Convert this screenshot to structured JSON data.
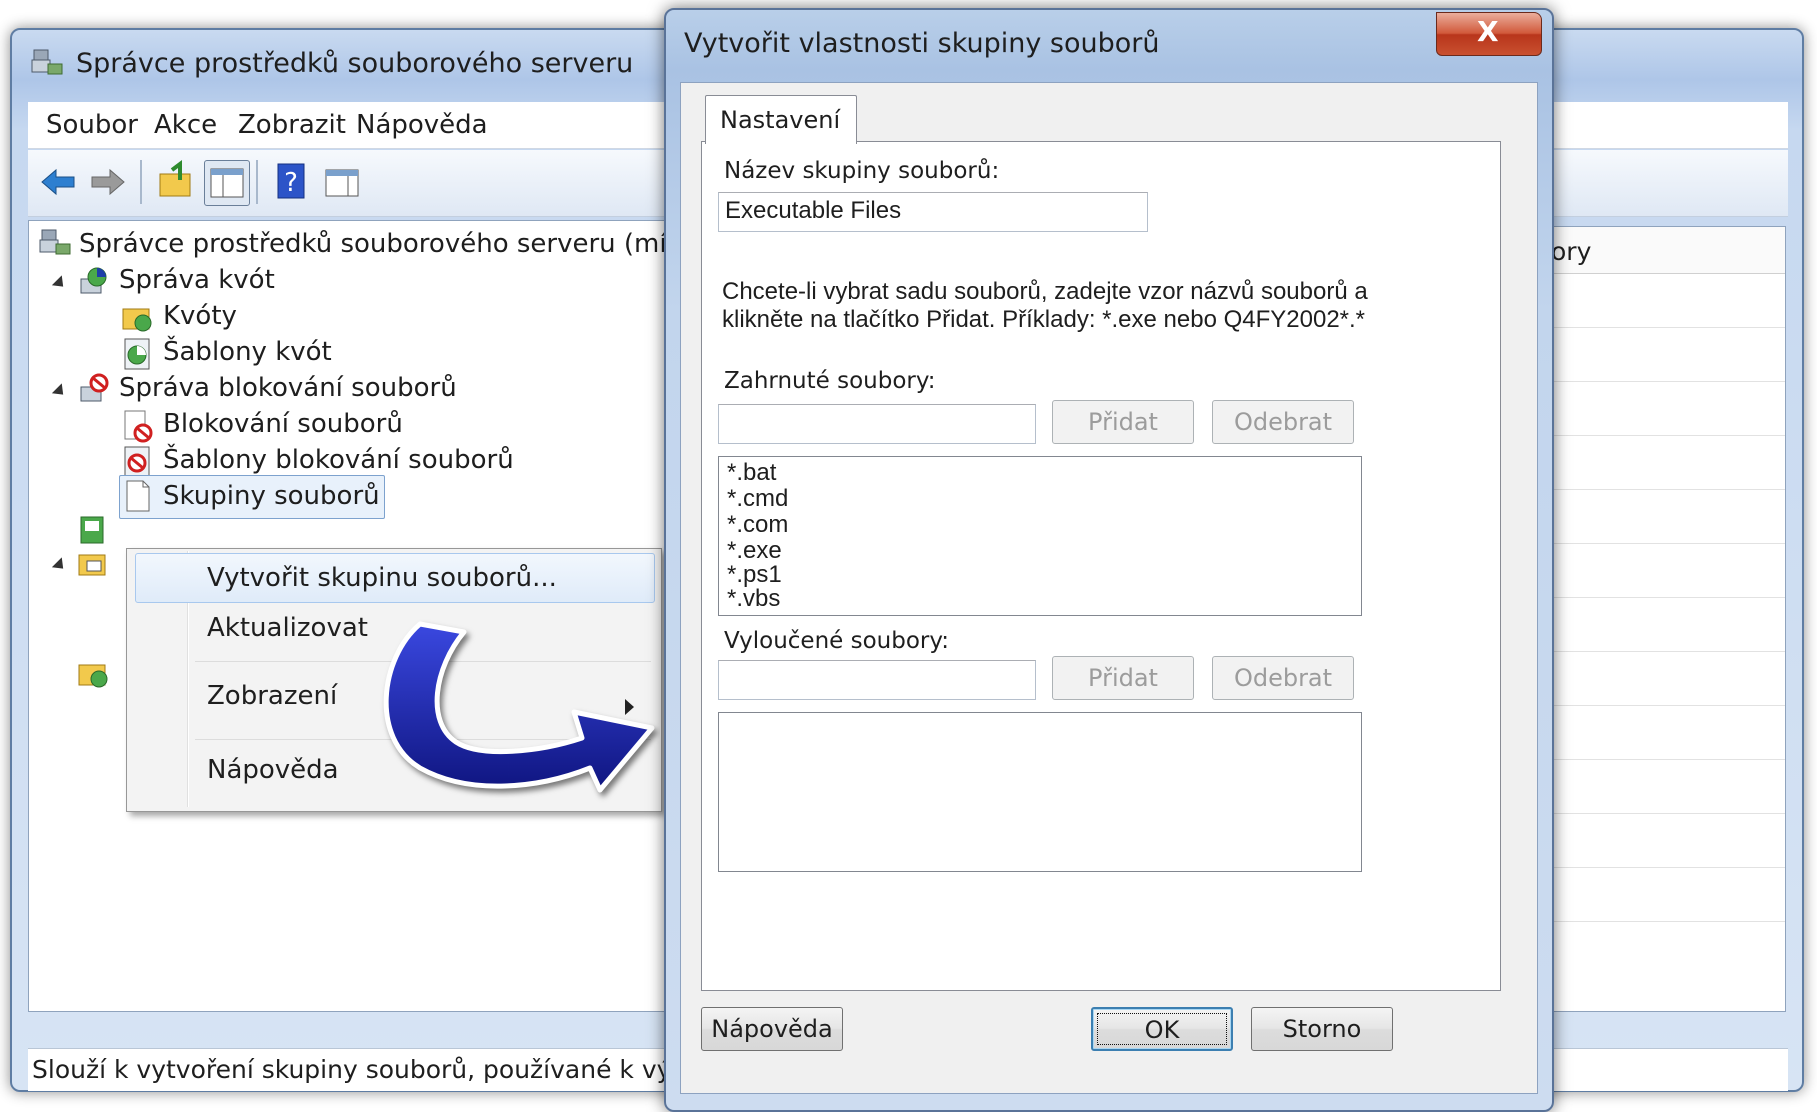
{
  "main_window": {
    "title": "Správce prostředků souborového serveru",
    "menu": [
      "Soubor",
      "Akce",
      "Zobrazit",
      "Nápověda"
    ],
    "toolbar_icons": [
      "back-arrow-icon",
      "forward-arrow-icon",
      "up-folder-icon",
      "show-hide-tree-icon",
      "help-icon",
      "action-pane-icon"
    ],
    "tree": {
      "root": "Správce prostředků souborového serveru (místní)",
      "items": [
        {
          "label": "Správa kvót",
          "icon": "quota-management-icon"
        },
        {
          "label": "Kvóty",
          "icon": "quotas-folder-icon"
        },
        {
          "label": "Šablony kvót",
          "icon": "quota-templates-icon"
        },
        {
          "label": "Správa blokování souborů",
          "icon": "file-screening-icon"
        },
        {
          "label": "Blokování souborů",
          "icon": "file-screens-icon"
        },
        {
          "label": "Šablony blokování souborů",
          "icon": "file-screen-templates-icon"
        },
        {
          "label": "Skupiny souborů",
          "icon": "file-groups-icon"
        }
      ]
    },
    "right_header_partial": "ory",
    "status_text": "Slouží k vytvoření skupiny souborů, používané k výbě"
  },
  "context_menu": {
    "items": [
      {
        "label": "Vytvořit skupinu souborů...",
        "highlighted": true
      },
      {
        "label": "Aktualizovat"
      },
      {
        "label": "Zobrazení",
        "submenu": true
      },
      {
        "label": "Nápověda"
      }
    ]
  },
  "dialog": {
    "title": "Vytvořit vlastnosti skupiny souborů",
    "tab": "Nastavení",
    "name_label": "Název skupiny souborů:",
    "name_value": "Executable Files",
    "hint_line1": "Chcete-li vybrat sadu souborů, zadejte vzor názvů souborů a",
    "hint_line2": "klikněte na tlačítko Přidat. Příklady: *.exe nebo Q4FY2002*.*",
    "included_label": "Zahrnuté soubory:",
    "included_input": "",
    "included_files": [
      "*.bat",
      "*.cmd",
      "*.com",
      "*.exe",
      "*.ps1",
      "*.vbs"
    ],
    "excluded_label": "Vyloučené soubory:",
    "excluded_input": "",
    "add_button": "Přidat",
    "remove_button": "Odebrat",
    "help_button": "Nápověda",
    "ok_button": "OK",
    "cancel_button": "Storno",
    "close_glyph": "X"
  },
  "colors": {
    "arrow": "#1a22b0",
    "window_frame": "#aec6e8",
    "close_button": "#c8462c"
  }
}
